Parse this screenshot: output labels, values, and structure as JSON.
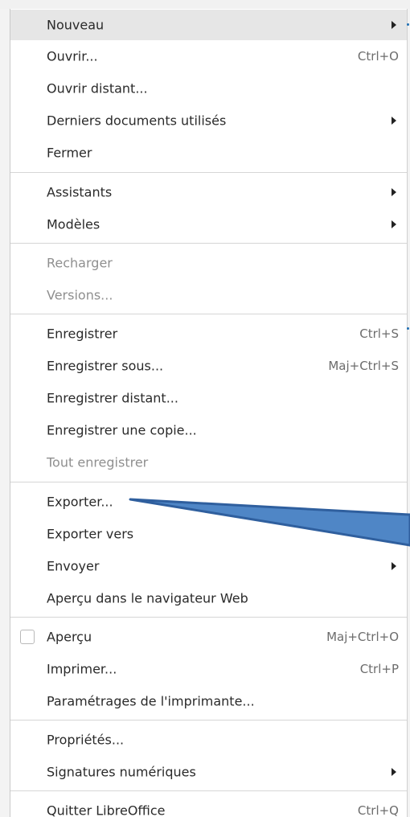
{
  "menu": {
    "items": [
      {
        "label": "Nouveau",
        "shortcut": "",
        "submenu": true,
        "disabled": false,
        "highlight": true
      },
      {
        "label": "Ouvrir...",
        "shortcut": "Ctrl+O",
        "submenu": false,
        "disabled": false
      },
      {
        "label": "Ouvrir distant...",
        "shortcut": "",
        "submenu": false,
        "disabled": false
      },
      {
        "label": "Derniers documents utilisés",
        "shortcut": "",
        "submenu": true,
        "disabled": false
      },
      {
        "label": "Fermer",
        "shortcut": "",
        "submenu": false,
        "disabled": false
      },
      {
        "label": "Assistants",
        "shortcut": "",
        "submenu": true,
        "disabled": false
      },
      {
        "label": "Modèles",
        "shortcut": "",
        "submenu": true,
        "disabled": false
      },
      {
        "label": "Recharger",
        "shortcut": "",
        "submenu": false,
        "disabled": true
      },
      {
        "label": "Versions...",
        "shortcut": "",
        "submenu": false,
        "disabled": true
      },
      {
        "label": "Enregistrer",
        "shortcut": "Ctrl+S",
        "submenu": false,
        "disabled": false
      },
      {
        "label": "Enregistrer sous...",
        "shortcut": "Maj+Ctrl+S",
        "submenu": false,
        "disabled": false
      },
      {
        "label": "Enregistrer distant...",
        "shortcut": "",
        "submenu": false,
        "disabled": false
      },
      {
        "label": "Enregistrer une copie...",
        "shortcut": "",
        "submenu": false,
        "disabled": false
      },
      {
        "label": "Tout enregistrer",
        "shortcut": "",
        "submenu": false,
        "disabled": true
      },
      {
        "label": "Exporter...",
        "shortcut": "",
        "submenu": false,
        "disabled": false
      },
      {
        "label": "Exporter vers",
        "shortcut": "",
        "submenu": false,
        "disabled": false
      },
      {
        "label": "Envoyer",
        "shortcut": "",
        "submenu": true,
        "disabled": false
      },
      {
        "label": "Aperçu dans le navigateur Web",
        "shortcut": "",
        "submenu": false,
        "disabled": false
      },
      {
        "label": "Aperçu",
        "shortcut": "Maj+Ctrl+O",
        "submenu": false,
        "disabled": false,
        "checkbox": true,
        "checked": false
      },
      {
        "label": "Imprimer...",
        "shortcut": "Ctrl+P",
        "submenu": false,
        "disabled": false
      },
      {
        "label": "Paramétrages de l'imprimante...",
        "shortcut": "",
        "submenu": false,
        "disabled": false
      },
      {
        "label": "Propriétés...",
        "shortcut": "",
        "submenu": false,
        "disabled": false
      },
      {
        "label": "Signatures numériques",
        "shortcut": "",
        "submenu": true,
        "disabled": false
      },
      {
        "label": "Quitter LibreOffice",
        "shortcut": "Ctrl+Q",
        "submenu": false,
        "disabled": false
      }
    ]
  },
  "annotation": {
    "callout_color": "#2f5f9e",
    "callout_fill": "#4f86c6",
    "points_to": "Exporter..."
  }
}
